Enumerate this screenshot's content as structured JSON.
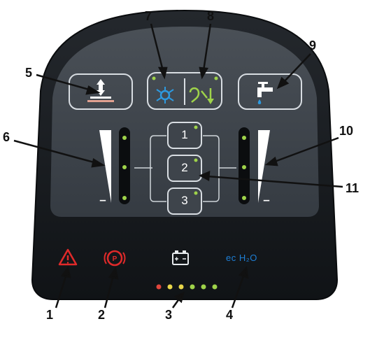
{
  "callouts": {
    "n1": "1",
    "n2": "2",
    "n3": "3",
    "n4": "4",
    "n5": "5",
    "n6": "6",
    "n7": "7",
    "n8": "8",
    "n9": "9",
    "n10": "10",
    "n11": "11"
  },
  "pressure_buttons": {
    "b1": "1",
    "b2": "2",
    "b3": "3"
  },
  "indicators": {
    "plus_left": "+",
    "minus_left": "–",
    "plus_right": "+",
    "minus_right": "–",
    "brand": "ec H₂O"
  },
  "colors": {
    "panel": "#16191d",
    "inner": "#3b4148",
    "button_outline": "#d8dde2",
    "led_green": "#9fd34a",
    "warning_red": "#e02a2a",
    "brand_blue": "#1e7fd6"
  },
  "battery_leds": [
    "red",
    "yellow",
    "yellow",
    "green",
    "green",
    "green"
  ],
  "icons": {
    "warning": "warning-triangle-icon",
    "parking_brake": "parking-brake-icon",
    "battery": "battery-icon",
    "scrub_head": "scrub-head-lift-icon",
    "vacuum": "vacuum-fan-icon",
    "squeegee": "squeegee-icon",
    "solution": "solution-faucet-icon"
  }
}
